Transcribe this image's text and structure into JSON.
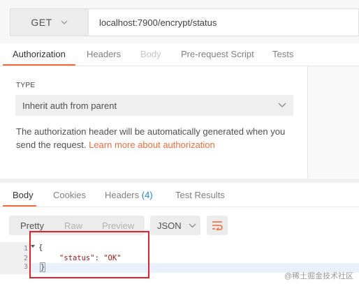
{
  "request": {
    "method": "GET",
    "url": "localhost:7900/encrypt/status"
  },
  "request_tabs": [
    "Authorization",
    "Headers",
    "Body",
    "Pre-request Script",
    "Tests"
  ],
  "auth": {
    "type_label": "TYPE",
    "selected_type": "Inherit auth from parent",
    "description": "The authorization header will be automatically generated when you send the request.",
    "link_text": "Learn more about authorization"
  },
  "response_tabs": {
    "body": "Body",
    "cookies": "Cookies",
    "headers": "Headers",
    "headers_count": "(4)",
    "test_results": "Test Results"
  },
  "view_modes": [
    "Pretty",
    "Raw",
    "Preview"
  ],
  "format": "JSON",
  "code": {
    "line_numbers": [
      "1",
      "2",
      "3"
    ],
    "open_brace": "{",
    "key": "\"status\"",
    "colon": ": ",
    "value": "\"OK\"",
    "close_brace": "}"
  },
  "watermark": "@稀土掘金技术社区",
  "colors": {
    "accent": "#f26b3a",
    "link": "#1f86d6",
    "annotation": "#e8202a"
  }
}
